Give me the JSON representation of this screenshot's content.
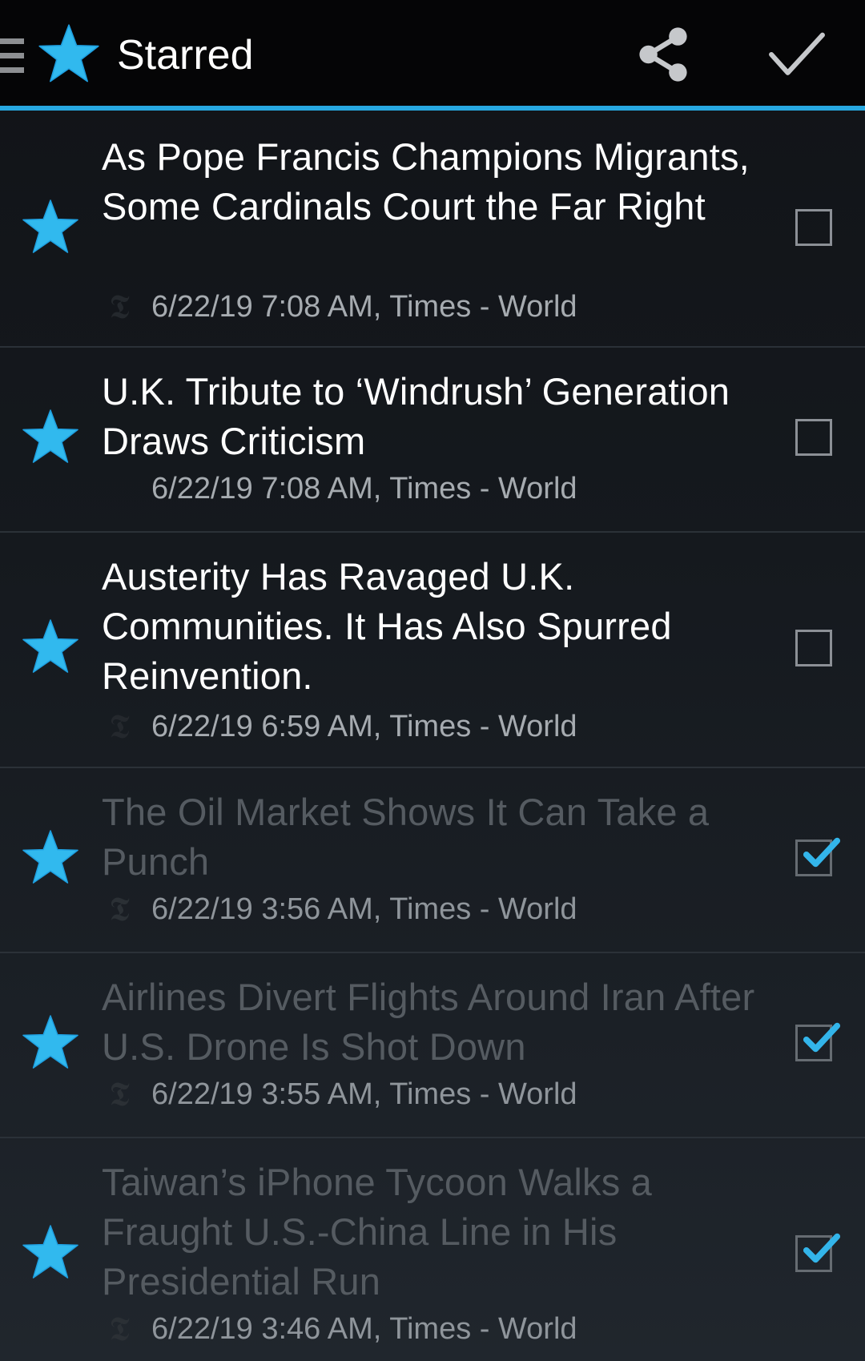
{
  "app": {
    "title": "Starred",
    "accent_color": "#27a8e0",
    "star_color": "#31b9ee",
    "toolbar_icons": [
      "drawer-menu-icon",
      "star-icon",
      "share-icon",
      "checkmark-icon"
    ]
  },
  "articles": [
    {
      "title": "As Pope Francis Champions Migrants, Some Cardinals Court the Far Right",
      "meta": "6/22/19 7:08 AM, Times - World",
      "source_logo": "𝕿",
      "starred": true,
      "read": false
    },
    {
      "title": "U.K. Tribute to ‘Windrush’ Generation Draws Criticism",
      "meta": "6/22/19 7:08 AM, Times - World",
      "source_logo": "",
      "starred": true,
      "read": false
    },
    {
      "title": "Austerity Has Ravaged U.K. Communities. It Has Also Spurred Reinvention.",
      "meta": "6/22/19 6:59 AM, Times - World",
      "source_logo": "𝕿",
      "starred": true,
      "read": false
    },
    {
      "title": "The Oil Market Shows It Can Take a Punch",
      "meta": "6/22/19 3:56 AM, Times - World",
      "source_logo": "𝕿",
      "starred": true,
      "read": true
    },
    {
      "title": "Airlines Divert Flights Around Iran After U.S. Drone Is Shot Down",
      "meta": "6/22/19 3:55 AM, Times - World",
      "source_logo": "𝕿",
      "starred": true,
      "read": true
    },
    {
      "title": "Taiwan’s iPhone Tycoon Walks a Fraught U.S.-China Line in His Presidential Run",
      "meta": "6/22/19 3:46 AM, Times - World",
      "source_logo": "𝕿",
      "starred": true,
      "read": true
    }
  ]
}
